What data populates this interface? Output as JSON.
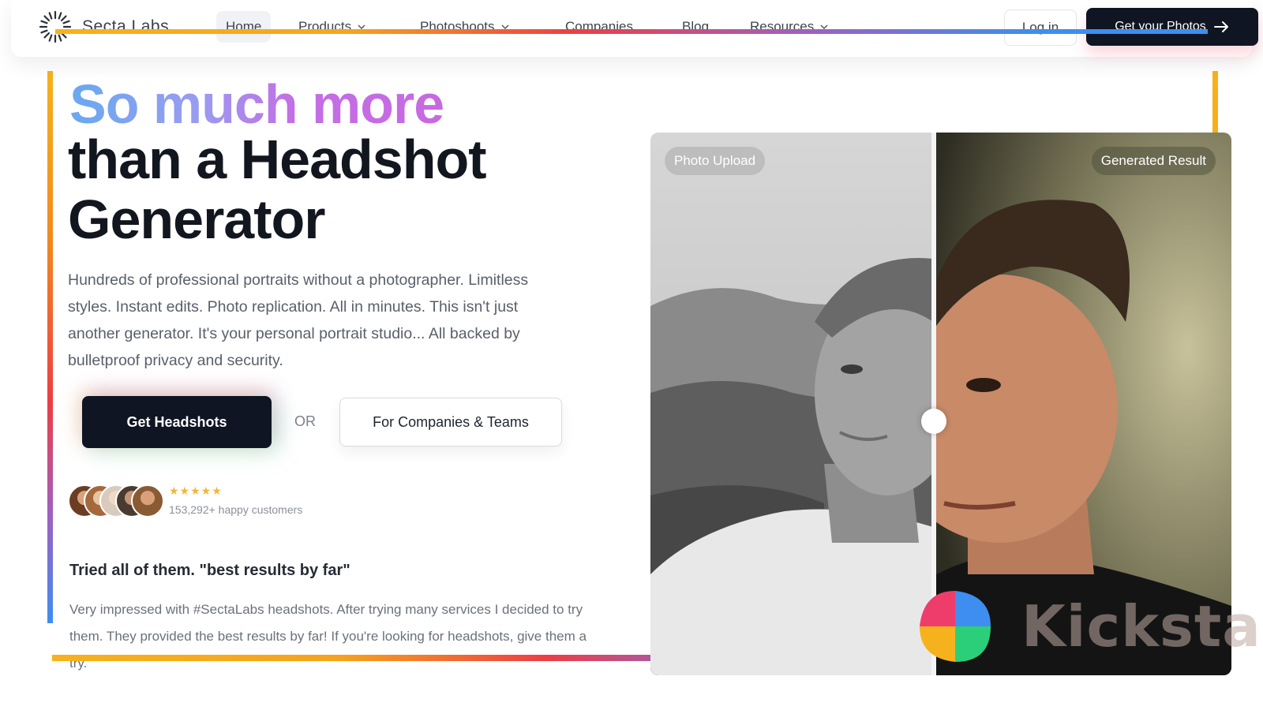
{
  "nav": {
    "brand": "Secta Labs",
    "logo_icon": "sunburst-logo-icon",
    "items": [
      {
        "label": "Home",
        "active": true
      },
      {
        "label": "Products",
        "dropdown": true
      },
      {
        "label": "Photoshoots",
        "dropdown": true
      },
      {
        "label": "Companies"
      },
      {
        "label": "Blog"
      },
      {
        "label": "Resources",
        "dropdown": true
      }
    ],
    "login_label": "Log in",
    "cta_label": "Get your Photos",
    "cta_icon": "arrow-right-icon"
  },
  "hero": {
    "headline_gradient": "So much more",
    "headline_line2": "than a Headshot",
    "headline_line3": "Generator",
    "description": "Hundreds of professional portraits without a photographer. Limitless styles. Instant edits. Photo replication. All in minutes. This isn't just another generator. It's your personal portrait studio... All backed by bulletproof privacy and security.",
    "primary_cta": "Get Headshots",
    "or_label": "OR",
    "secondary_cta": "For Companies & Teams"
  },
  "social_proof": {
    "rating": 5,
    "stars": "★★★★★",
    "customers": "153,292+ happy customers"
  },
  "testimonial": {
    "title": "Tried all of them. \"best results by far\"",
    "body": "Very impressed with #SectaLabs headshots. After trying many services I decided to try them. They provided the best results by far! If you're looking for headshots, give them a try."
  },
  "comparison": {
    "left_tag": "Photo Upload",
    "right_tag": "Generated Result"
  },
  "watermark": {
    "text": "Kicksta",
    "icon": "kicksta-pinwheel-icon"
  },
  "colors": {
    "accent_dark": "#0f1522",
    "gradient_orange": "#f6b21c",
    "gradient_red": "#ee3d44",
    "gradient_purple": "#a060c0",
    "gradient_blue": "#3d8ef0",
    "star": "#f1b53d"
  }
}
